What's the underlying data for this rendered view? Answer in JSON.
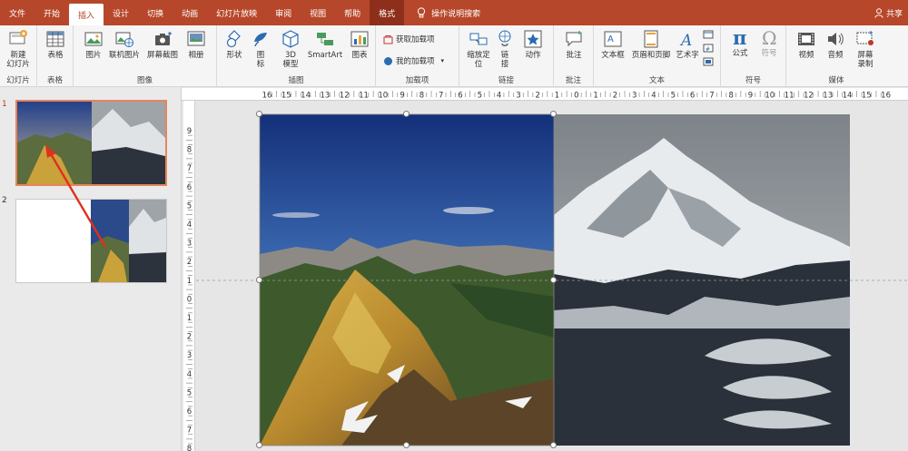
{
  "tabs": [
    {
      "label": "文件",
      "state": "normal"
    },
    {
      "label": "开始",
      "state": "normal"
    },
    {
      "label": "插入",
      "state": "active"
    },
    {
      "label": "设计",
      "state": "normal"
    },
    {
      "label": "切换",
      "state": "normal"
    },
    {
      "label": "动画",
      "state": "normal"
    },
    {
      "label": "幻灯片放映",
      "state": "normal"
    },
    {
      "label": "审阅",
      "state": "normal"
    },
    {
      "label": "视图",
      "state": "normal"
    },
    {
      "label": "帮助",
      "state": "normal"
    },
    {
      "label": "格式",
      "state": "format"
    }
  ],
  "tell_me": "操作说明搜索",
  "share": "共享",
  "ribbon": {
    "slides": {
      "new_slide_line1": "新建",
      "new_slide_line2": "幻灯片",
      "group": "幻灯片"
    },
    "tables": {
      "table": "表格",
      "group": "表格"
    },
    "images": {
      "picture": "图片",
      "online_picture": "联机图片",
      "screenshot": "屏幕截图",
      "album": "相册",
      "group": "图像"
    },
    "illustrations": {
      "shapes": "形状",
      "icons_line1": "图",
      "icons_line2": "标",
      "model_line1": "3D",
      "model_line2": "模型",
      "smartart": "SmartArt",
      "chart": "图表",
      "group": "插图"
    },
    "addins": {
      "get": "获取加载项",
      "my": "我的加载项",
      "group": "加载项"
    },
    "links": {
      "zoom_line1": "缩放定",
      "zoom_line2": "位",
      "link_line1": "链",
      "link_line2": "接",
      "action": "动作",
      "group": "链接"
    },
    "comments": {
      "comment": "批注",
      "group": "批注"
    },
    "text": {
      "textbox": "文本框",
      "header_footer": "页眉和页脚",
      "wordart": "艺术字",
      "group": "文本"
    },
    "symbols": {
      "equation": "公式",
      "symbol": "符号",
      "group": "符号"
    },
    "media": {
      "video": "视频",
      "audio": "音频",
      "screen_rec_line1": "屏幕",
      "screen_rec_line2": "录制",
      "group": "媒体"
    }
  },
  "slides": [
    {
      "number": "1",
      "selected": true
    },
    {
      "number": "2",
      "selected": false
    }
  ],
  "ruler": {
    "h_labels": [
      "16",
      "15",
      "14",
      "13",
      "12",
      "11",
      "10",
      "9",
      "8",
      "7",
      "6",
      "5",
      "4",
      "3",
      "2",
      "1",
      "0",
      "1",
      "2",
      "3",
      "4",
      "5",
      "6",
      "7",
      "8",
      "9",
      "10",
      "11",
      "12",
      "13",
      "14",
      "15",
      "16"
    ],
    "v_labels": [
      "9",
      "8",
      "7",
      "6",
      "5",
      "4",
      "3",
      "2",
      "1",
      "0",
      "1",
      "2",
      "3",
      "4",
      "5",
      "6",
      "7",
      "8",
      "9"
    ]
  },
  "colors": {
    "accent": "#b7472a",
    "format_tab": "#8e2f1b",
    "selection": "#e8845c",
    "arrow": "#e0301e"
  }
}
